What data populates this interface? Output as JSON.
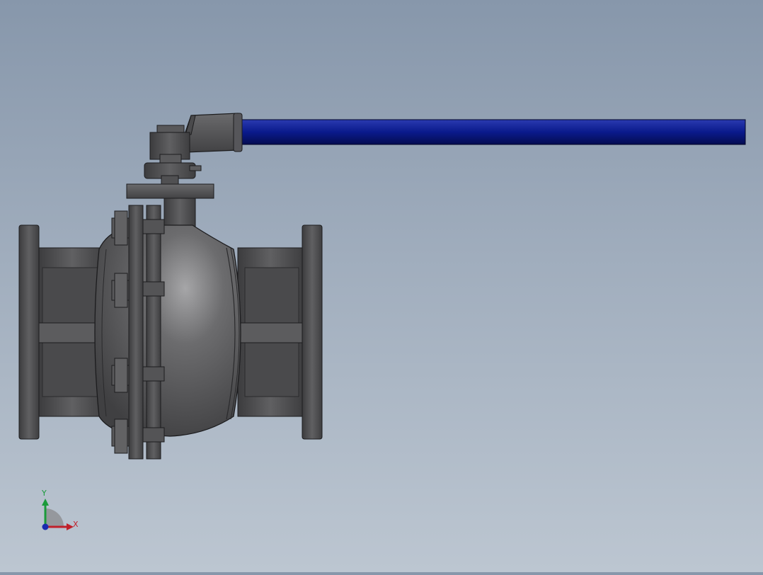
{
  "window": {
    "title": ""
  },
  "viewport": {
    "background_top": "#8797ab",
    "background_bottom": "#bcc6d1",
    "model": "ball-valve",
    "handle_color": "#0a1a8c",
    "body_color": "#5a5a5c"
  },
  "triad": {
    "x_label": "X",
    "y_label": "Y",
    "x_color": "#c0202a",
    "y_color": "#1a9a3a",
    "z_color": "#1a2ab0"
  }
}
